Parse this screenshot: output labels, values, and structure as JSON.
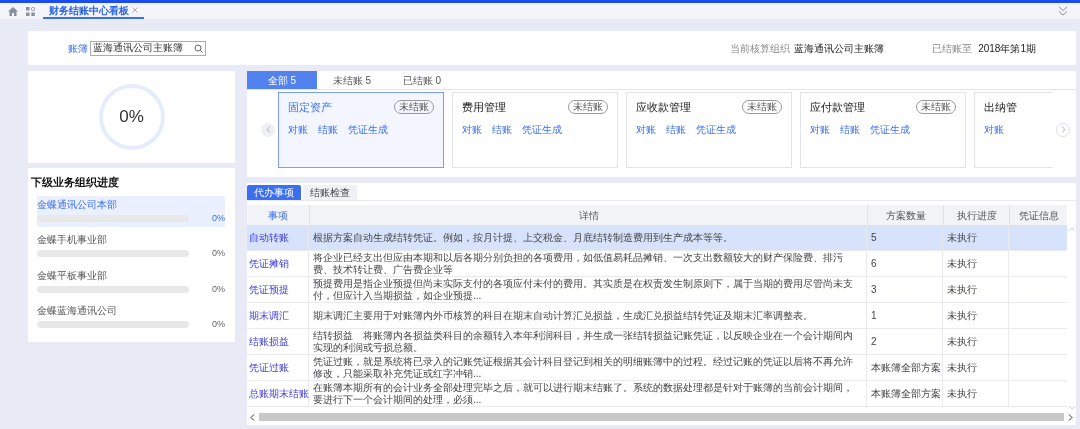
{
  "page_tabs": [
    {
      "label": "财务结账中心看板",
      "selected": true
    }
  ],
  "header": {
    "ledger_label": "账簿",
    "ledger_value": "蓝海通讯公司主账簿",
    "org_label": "当前核算组织",
    "org_value": "蓝海通讯公司主账簿",
    "closed_label": "已结账至",
    "closed_value": "2018年第1期"
  },
  "overall": {
    "percent": "0%",
    "level": 0
  },
  "sub_orgs": {
    "title": "下级业务组织进度",
    "items": [
      {
        "name": "金蝶通讯公司本部",
        "percent": "0%",
        "level": 0,
        "selected": true
      },
      {
        "name": "金蝶手机事业部",
        "percent": "0%",
        "level": 0,
        "selected": false
      },
      {
        "name": "金蝶平板事业部",
        "percent": "0%",
        "level": 0,
        "selected": false
      },
      {
        "name": "金蝶蓝海通讯公司",
        "percent": "0%",
        "level": 0,
        "selected": false
      }
    ]
  },
  "status_tabs": [
    {
      "label": "全部 5",
      "selected": true
    },
    {
      "label": "未结账 5",
      "selected": false
    },
    {
      "label": "已结账 0",
      "selected": false
    }
  ],
  "modules": [
    {
      "title": "固定资产",
      "badge": "未结账",
      "actions": [
        "对账",
        "结账",
        "凭证生成"
      ],
      "selected": true
    },
    {
      "title": "费用管理",
      "badge": "未结账",
      "actions": [
        "对账",
        "结账",
        "凭证生成"
      ],
      "selected": false
    },
    {
      "title": "应收款管理",
      "badge": "未结账",
      "actions": [
        "对账",
        "结账",
        "凭证生成"
      ],
      "selected": false
    },
    {
      "title": "应付款管理",
      "badge": "未结账",
      "actions": [
        "对账",
        "结账",
        "凭证生成"
      ],
      "selected": false
    },
    {
      "title": "出纳管",
      "actions": [
        "对账"
      ],
      "selected": false
    }
  ],
  "task_tabs": [
    {
      "label": "代办事项",
      "selected": true
    },
    {
      "label": "结账检查",
      "selected": false
    }
  ],
  "table": {
    "columns": [
      "事项",
      "详情",
      "方案数量",
      "执行进度",
      "凭证信息"
    ],
    "rows": [
      {
        "item": "自动转账",
        "detail": "根据方案自动生成结转凭证。例如，按月计提、上交税金、月底结转制造费用到生产成本等等。",
        "count": "5",
        "progress": "未执行",
        "selected": true
      },
      {
        "item": "凭证摊销",
        "detail": "将企业已经支出但应由本期和以后各期分别负担的各项费用，如低值易耗品摊销、一次支出数额较大的财产保险费、排污费、技术转让费、广告费企业等",
        "count": "6",
        "progress": "未执行",
        "selected": false
      },
      {
        "item": "凭证预提",
        "detail": "预提费用是指企业预提但尚未实际支付的各项应付未付的费用。其实质是在权责发生制原则下，属于当期的费用尽管尚未支付，但应计入当期损益，如企业预提...",
        "count": "3",
        "progress": "未执行",
        "selected": false
      },
      {
        "item": "期末调汇",
        "detail": "期末调汇主要用于对账簿内外币核算的科目在期末自动计算汇兑损益，生成汇兑损益结转凭证及期末汇率调整表。",
        "count": "1",
        "progress": "未执行",
        "selected": false
      },
      {
        "item": "结账损益",
        "detail": "结转损益　将账簿内各损益类科目的余额转入本年利润科目，并生成一张结转损益记账凭证，以反映企业在一个会计期间内实现的利润或亏损总额。",
        "count": "2",
        "progress": "未执行",
        "selected": false
      },
      {
        "item": "凭证过账",
        "detail": "凭证过账，就是系统将已录入的记账凭证根据其会计科目登记到相关的明细账簿中的过程。经过记账的凭证以后将不再允许修改，只能采取补充凭证或红字冲销...",
        "count": "本账簿全部方案",
        "progress": "未执行",
        "selected": false
      },
      {
        "item": "总账期末结账",
        "detail": "在账簿本期所有的会计业务全部处理完毕之后，就可以进行期末结账了。系统的数据处理都是针对于账簿的当前会计期间，要进行下一个会计期间的处理，必须...",
        "count": "本账簿全部方案",
        "progress": "未执行",
        "selected": false
      }
    ]
  }
}
